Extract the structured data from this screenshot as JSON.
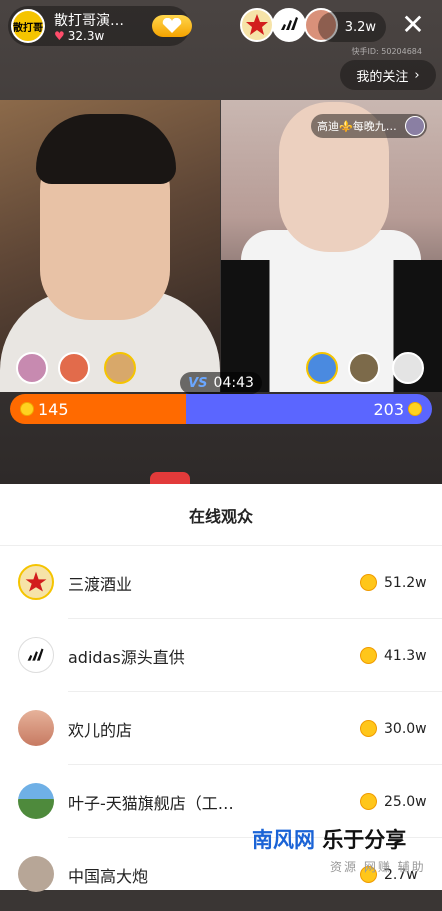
{
  "header": {
    "host_avatar_text": "散打哥",
    "host_name": "散打哥演…",
    "likes": "32.3w",
    "viewer_avatars": [
      "viewer-avatar-1",
      "viewer-avatar-2",
      "viewer-avatar-3"
    ],
    "viewer_count": "3.2w",
    "ks_id": "快手ID: 50204684",
    "my_follow": "我的关注"
  },
  "pk": {
    "right_tag": "高迪⚜️每晚九…",
    "timer": "04:43",
    "left_score": "145",
    "right_score": "203",
    "left_fraction": 0.417,
    "colors": {
      "left": "#ff6a00",
      "right": "#5b66ff"
    }
  },
  "sheet": {
    "title": "在线观众",
    "rows": [
      {
        "name": "三渡酒业",
        "value": "51.2w",
        "avatar": "star-logo"
      },
      {
        "name": "adidas源头直供",
        "value": "41.3w",
        "avatar": "adidas-logo"
      },
      {
        "name": "欢儿的店",
        "value": "30.0w",
        "avatar": "person-photo"
      },
      {
        "name": "叶子-天猫旗舰店（工…",
        "value": "25.0w",
        "avatar": "landscape-photo"
      },
      {
        "name": "中国高大炮",
        "value": "2.7w",
        "avatar": "person-photo"
      }
    ]
  },
  "watermark": {
    "part1": "南风网",
    "part2": "乐于分享",
    "sub": "资源 网赚 辅助"
  }
}
